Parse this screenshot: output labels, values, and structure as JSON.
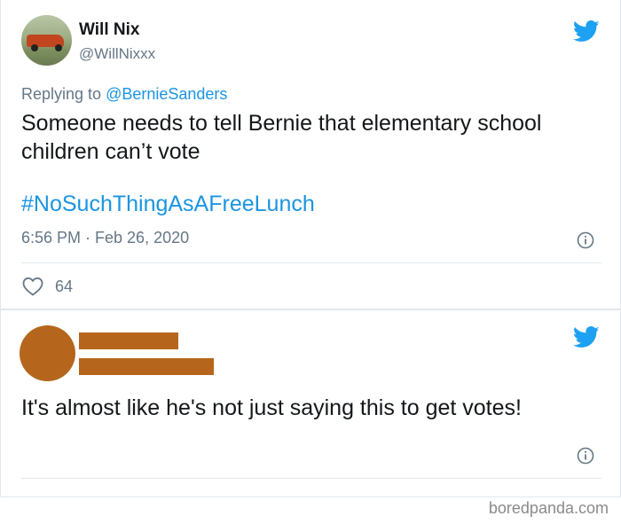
{
  "tweet1": {
    "display_name": "Will Nix",
    "handle": "@WillNixxx",
    "replying_prefix": "Replying to ",
    "replying_to": "@BernieSanders",
    "text": "Someone needs to tell Bernie that elementary school children can’t vote",
    "hashtag": "#NoSuchThingAsAFreeLunch",
    "timestamp": "6:56 PM · Feb 26, 2020",
    "like_count": "64"
  },
  "tweet2": {
    "text": "It's almost like he's not just saying this to get votes!"
  },
  "watermark": "boredpanda.com",
  "colors": {
    "twitter_blue": "#1da1f2",
    "link_blue": "#1b95e0",
    "muted_gray": "#657786",
    "border": "#e1e8ed",
    "redaction": "#b5661c"
  },
  "icons": {
    "bird": "twitter-bird-icon",
    "info": "info-icon",
    "like": "heart-outline-icon"
  }
}
